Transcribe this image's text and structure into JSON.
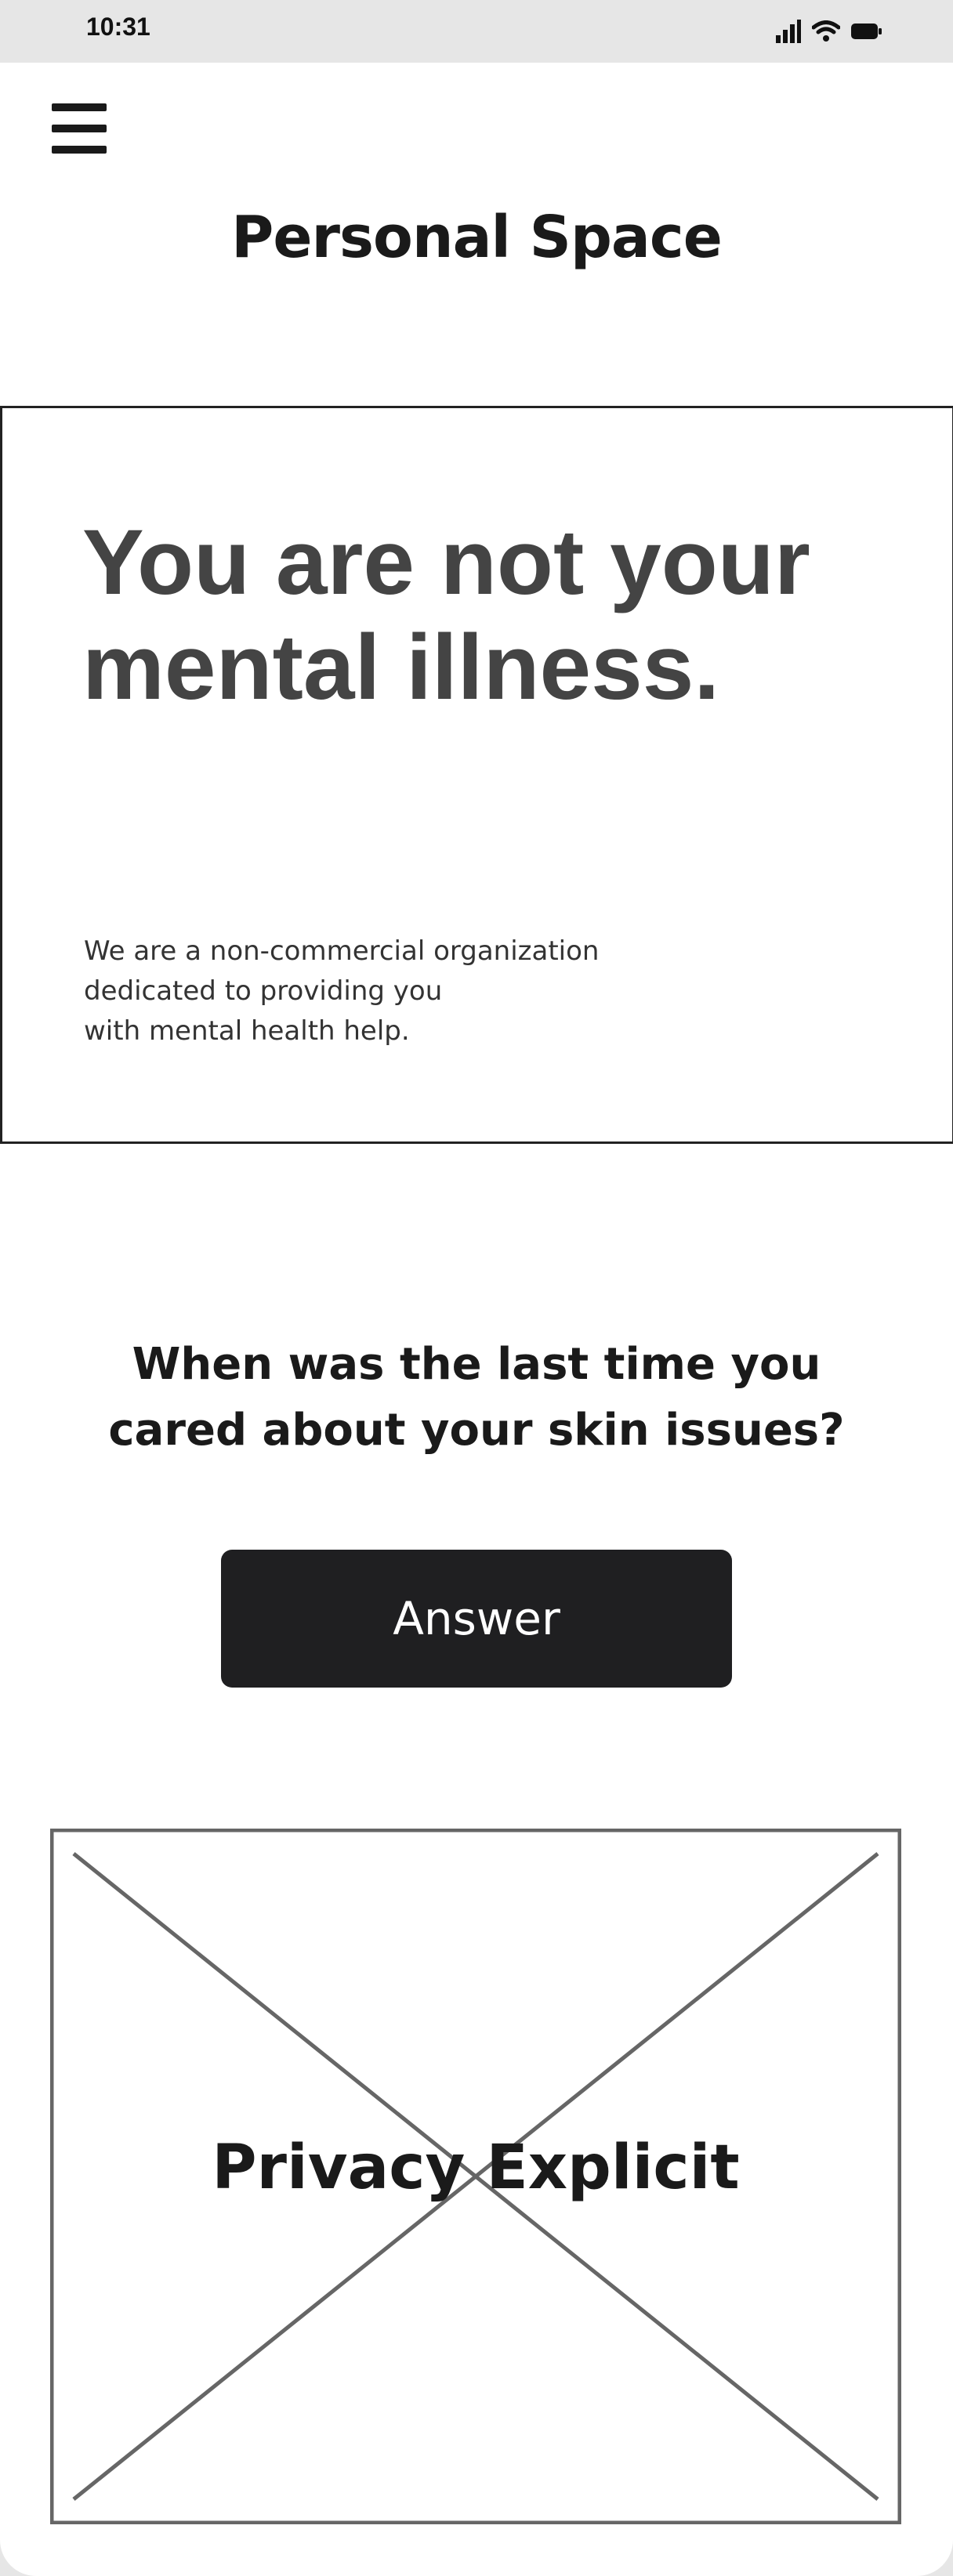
{
  "status_bar": {
    "time": "10:31",
    "icons": [
      "cellular-signal-icon",
      "wifi-icon",
      "battery-icon"
    ]
  },
  "header": {
    "menu_icon": "hamburger-menu-icon",
    "title": "Personal Space"
  },
  "hero": {
    "headline": "You are not your mental illness.",
    "description": "We are a non-commercial organization\ndedicated to providing you\nwith mental health help."
  },
  "prompt": {
    "question": "When was the last time you\ncared about your skin issues?",
    "answer_label": "Answer"
  },
  "image_placeholder": {
    "label": "Privacy Explicit"
  },
  "colors": {
    "primary_button": "#1f1f21",
    "headline_text": "#444444",
    "placeholder_stroke": "#666666"
  }
}
